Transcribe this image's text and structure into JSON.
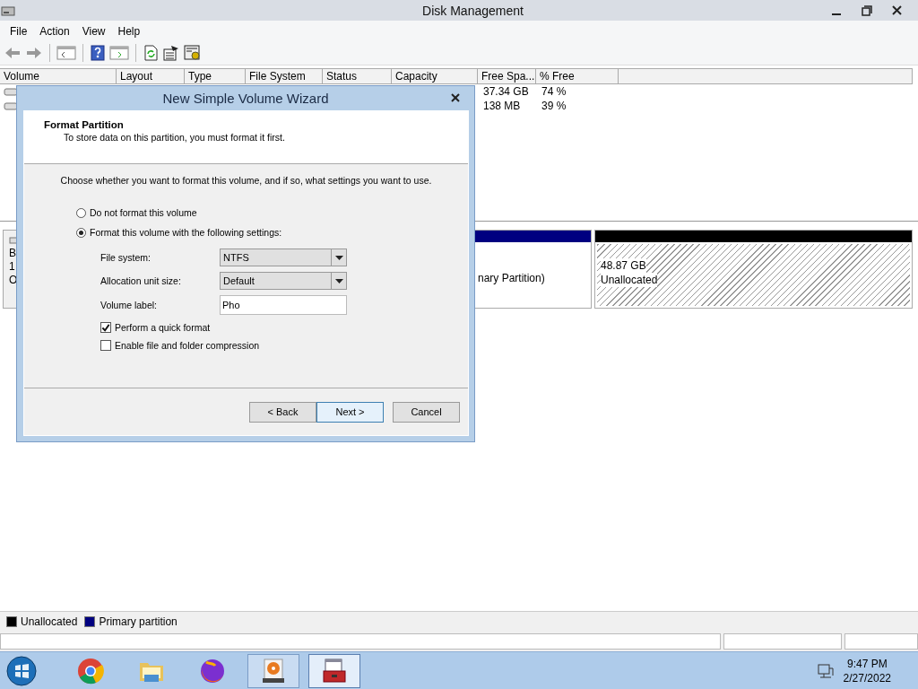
{
  "window": {
    "title": "Disk Management"
  },
  "menu": [
    "File",
    "Action",
    "View",
    "Help"
  ],
  "volume_table": {
    "columns": [
      "Volume",
      "Layout",
      "Type",
      "File System",
      "Status",
      "Capacity",
      "Free Spa...",
      "% Free"
    ],
    "rows": [
      {
        "free_space": "37.34 GB",
        "percent_free": "74 %"
      },
      {
        "free_space": "138 MB",
        "percent_free": "39 %"
      }
    ]
  },
  "disk_map": {
    "disk_label": [
      "B",
      "1",
      "O"
    ],
    "partitions": [
      {
        "kind": "primary",
        "lines": [
          "nary Partition)"
        ]
      },
      {
        "kind": "unallocated",
        "lines": [
          "48.87 GB",
          "Unallocated"
        ]
      }
    ]
  },
  "legend": [
    {
      "label": "Unallocated",
      "color": "#000000"
    },
    {
      "label": "Primary partition",
      "color": "#000080"
    }
  ],
  "taskbar": {
    "apps": [
      {
        "kind": "browser",
        "open": false,
        "selected": false
      },
      {
        "kind": "folder",
        "open": false,
        "selected": false
      },
      {
        "kind": "globe",
        "open": false,
        "selected": false
      },
      {
        "kind": "disk",
        "open": true,
        "selected": false
      },
      {
        "kind": "toolbox",
        "open": true,
        "selected": true
      }
    ],
    "time": "9:47 PM",
    "date": "2/27/2022"
  },
  "wizard": {
    "title": "New Simple Volume Wizard",
    "heading": "Format Partition",
    "subheading": "To store data on this partition, you must format it first.",
    "instruction": "Choose whether you want to format this volume, and if so, what settings you want to use.",
    "options": [
      {
        "label": "Do not format this volume",
        "selected": false
      },
      {
        "label": "Format this volume with the following settings:",
        "selected": true
      }
    ],
    "fields": [
      {
        "kind": "dropdown",
        "label": "File system:",
        "value": "NTFS"
      },
      {
        "kind": "dropdown",
        "label": "Allocation unit size:",
        "value": "Default"
      },
      {
        "kind": "text",
        "label": "Volume label:",
        "value": "Pho"
      }
    ],
    "checkboxes": [
      {
        "label": "Perform a quick format",
        "checked": true
      },
      {
        "label": "Enable file and folder compression",
        "checked": false
      }
    ],
    "buttons": [
      {
        "label": "< Back",
        "default": false
      },
      {
        "label": "Next >",
        "default": true
      },
      {
        "label": "Cancel",
        "default": false
      }
    ]
  }
}
